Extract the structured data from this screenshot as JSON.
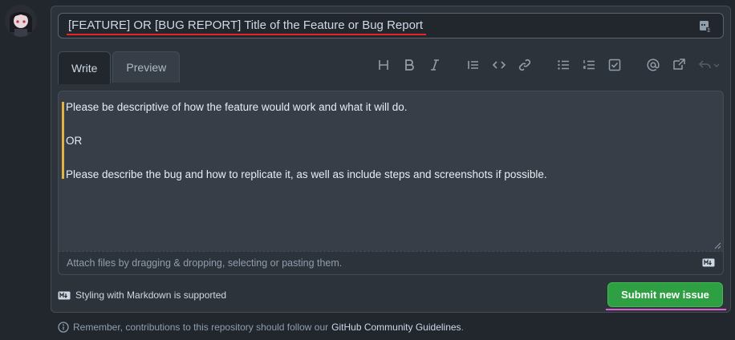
{
  "issue": {
    "title_value": "[FEATURE] OR [BUG REPORT] Title of the Feature or Bug Report"
  },
  "tabs": [
    {
      "label": "Write",
      "active": true
    },
    {
      "label": "Preview",
      "active": false
    }
  ],
  "toolbar": {
    "icons": [
      "heading-icon",
      "bold-icon",
      "italic-icon",
      "quote-icon",
      "code-icon",
      "link-icon",
      "bulleted-list-icon",
      "numbered-list-icon",
      "task-list-icon",
      "mention-icon",
      "cross-reference-icon",
      "reply-icon"
    ]
  },
  "body": {
    "lines": [
      "Please be descriptive of how the feature would work and what it will do.",
      "OR",
      "Please describe the bug and how to replicate it, as well as include steps and screenshots if possible."
    ]
  },
  "attach": {
    "text": "Attach files by dragging & dropping, selecting or pasting them."
  },
  "markdown": {
    "text": "Styling with Markdown is supported"
  },
  "submit": {
    "label": "Submit new issue"
  },
  "footer": {
    "text": "Remember, contributions to this repository should follow our",
    "link": "GitHub Community Guidelines",
    "end": "."
  },
  "colors": {
    "background": "#22272e",
    "accent_green": "#2ea043",
    "quote_bar": "#e3b341"
  }
}
